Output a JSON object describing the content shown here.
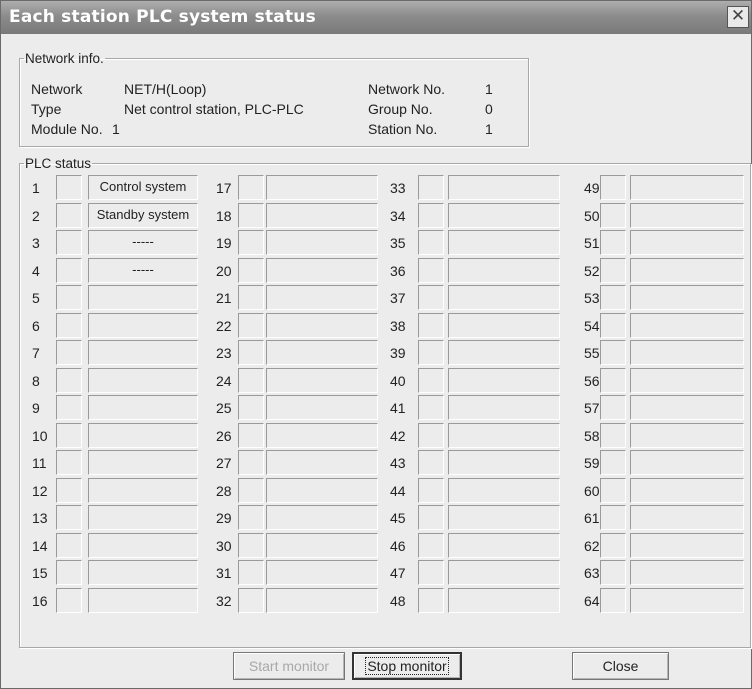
{
  "window": {
    "title": "Each station PLC system status",
    "close_glyph": "✕"
  },
  "network_info": {
    "legend": "Network info.",
    "network_label": "Network",
    "network_value": "NET/H(Loop)",
    "type_label": "Type",
    "type_value": "Net control station, PLC-PLC",
    "module_label": "Module No.",
    "module_value": "1",
    "network_no_label": "Network No.",
    "network_no_value": "1",
    "group_no_label": "Group No.",
    "group_no_value": "0",
    "station_no_label": "Station No.",
    "station_no_value": "1"
  },
  "plc_status": {
    "legend": "PLC status",
    "stations": [
      {
        "no": "1",
        "status": "Control system"
      },
      {
        "no": "2",
        "status": "Standby system"
      },
      {
        "no": "3",
        "status": "-----"
      },
      {
        "no": "4",
        "status": "-----"
      },
      {
        "no": "5",
        "status": ""
      },
      {
        "no": "6",
        "status": ""
      },
      {
        "no": "7",
        "status": ""
      },
      {
        "no": "8",
        "status": ""
      },
      {
        "no": "9",
        "status": ""
      },
      {
        "no": "10",
        "status": ""
      },
      {
        "no": "11",
        "status": ""
      },
      {
        "no": "12",
        "status": ""
      },
      {
        "no": "13",
        "status": ""
      },
      {
        "no": "14",
        "status": ""
      },
      {
        "no": "15",
        "status": ""
      },
      {
        "no": "16",
        "status": ""
      },
      {
        "no": "17",
        "status": ""
      },
      {
        "no": "18",
        "status": ""
      },
      {
        "no": "19",
        "status": ""
      },
      {
        "no": "20",
        "status": ""
      },
      {
        "no": "21",
        "status": ""
      },
      {
        "no": "22",
        "status": ""
      },
      {
        "no": "23",
        "status": ""
      },
      {
        "no": "24",
        "status": ""
      },
      {
        "no": "25",
        "status": ""
      },
      {
        "no": "26",
        "status": ""
      },
      {
        "no": "27",
        "status": ""
      },
      {
        "no": "28",
        "status": ""
      },
      {
        "no": "29",
        "status": ""
      },
      {
        "no": "30",
        "status": ""
      },
      {
        "no": "31",
        "status": ""
      },
      {
        "no": "32",
        "status": ""
      },
      {
        "no": "33",
        "status": ""
      },
      {
        "no": "34",
        "status": ""
      },
      {
        "no": "35",
        "status": ""
      },
      {
        "no": "36",
        "status": ""
      },
      {
        "no": "37",
        "status": ""
      },
      {
        "no": "38",
        "status": ""
      },
      {
        "no": "39",
        "status": ""
      },
      {
        "no": "40",
        "status": ""
      },
      {
        "no": "41",
        "status": ""
      },
      {
        "no": "42",
        "status": ""
      },
      {
        "no": "43",
        "status": ""
      },
      {
        "no": "44",
        "status": ""
      },
      {
        "no": "45",
        "status": ""
      },
      {
        "no": "46",
        "status": ""
      },
      {
        "no": "47",
        "status": ""
      },
      {
        "no": "48",
        "status": ""
      },
      {
        "no": "49",
        "status": ""
      },
      {
        "no": "50",
        "status": ""
      },
      {
        "no": "51",
        "status": ""
      },
      {
        "no": "52",
        "status": ""
      },
      {
        "no": "53",
        "status": ""
      },
      {
        "no": "54",
        "status": ""
      },
      {
        "no": "55",
        "status": ""
      },
      {
        "no": "56",
        "status": ""
      },
      {
        "no": "57",
        "status": ""
      },
      {
        "no": "58",
        "status": ""
      },
      {
        "no": "59",
        "status": ""
      },
      {
        "no": "60",
        "status": ""
      },
      {
        "no": "61",
        "status": ""
      },
      {
        "no": "62",
        "status": ""
      },
      {
        "no": "63",
        "status": ""
      },
      {
        "no": "64",
        "status": ""
      }
    ]
  },
  "buttons": {
    "start": "Start monitor",
    "stop": "Stop monitor",
    "close": "Close"
  }
}
